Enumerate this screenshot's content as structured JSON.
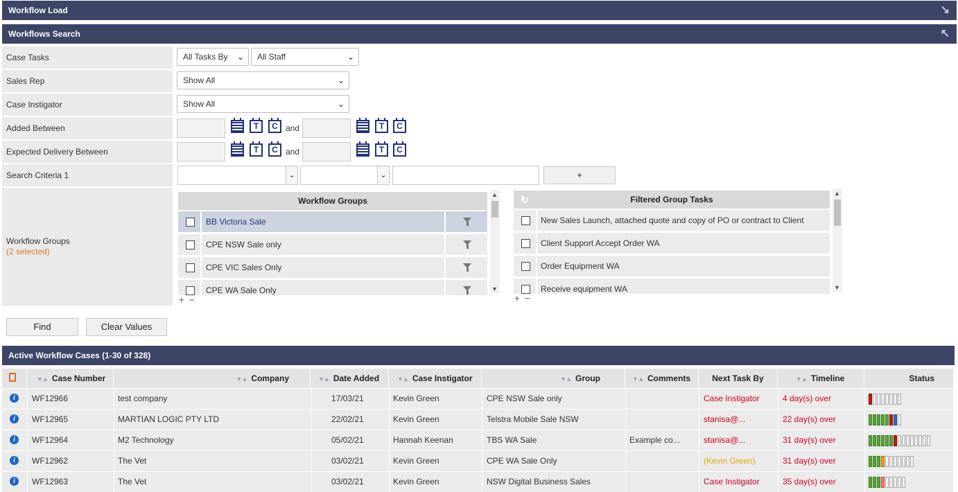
{
  "panels": {
    "workflow_load": "Workflow Load",
    "workflows_search": "Workflows Search",
    "active_cases": "Active Workflow Cases (1-30 of 328)"
  },
  "form": {
    "case_tasks_label": "Case Tasks",
    "case_tasks_by": "All Tasks By",
    "case_tasks_staff": "All Staff",
    "sales_rep_label": "Sales Rep",
    "sales_rep_value": "Show All",
    "case_instigator_label": "Case Instigator",
    "case_instigator_value": "Show All",
    "added_between_label": "Added Between",
    "expected_delivery_label": "Expected Delivery Between",
    "and_text": "and",
    "icon_t": "T",
    "icon_c": "C",
    "search_criteria_label": "Search Criteria 1",
    "add_criteria": "+",
    "workflow_groups_label": "Workflow Groups",
    "workflow_groups_selected": "(2 selected)"
  },
  "groups": {
    "header": "Workflow Groups",
    "items": [
      "BB Victoria Sale",
      "CPE NSW Sale only",
      "CPE VIC Sales Only",
      "CPE WA Sale Only"
    ]
  },
  "group_tasks": {
    "header": "Filtered Group Tasks",
    "items": [
      "New Sales Launch, attached quote and copy of PO or contract to Client",
      "Client Support Accept Order WA",
      "Order Equipment WA",
      "Receive equipment WA"
    ]
  },
  "buttons": {
    "find": "Find",
    "clear": "Clear Values"
  },
  "table": {
    "headers": {
      "case_number": "Case Number",
      "company": "Company",
      "date_added": "Date Added",
      "case_instigator": "Case Instigator",
      "group": "Group",
      "comments": "Comments",
      "next_task_by": "Next Task By",
      "timeline": "Timeline",
      "status": "Status"
    },
    "rows": [
      {
        "case": "WF12966",
        "company": "test company",
        "date": "17/03/21",
        "instigator": "Kevin Green",
        "group": "CPE NSW Sale only",
        "comments": "",
        "next": "Case Instigator",
        "next_color": "red",
        "timeline": "4 day(s) over"
      },
      {
        "case": "WF12965",
        "company": "MARTIAN LOGIC PTY LTD",
        "date": "22/02/21",
        "instigator": "Kevin Green",
        "group": "Telstra Mobile Sale NSW",
        "comments": "",
        "next": "stanisa@...",
        "next_color": "red",
        "timeline": "22 day(s) over"
      },
      {
        "case": "WF12964",
        "company": "M2 Technology",
        "date": "05/02/21",
        "instigator": "Hannah Keenan",
        "group": "TBS WA Sale",
        "comments": "Example co...",
        "next": "stanisa@...",
        "next_color": "red",
        "timeline": "31 day(s) over"
      },
      {
        "case": "WF12962",
        "company": "The Vet",
        "date": "03/02/21",
        "instigator": "Kevin Green",
        "group": "CPE WA Sale Only",
        "comments": "",
        "next": "(Kevin Green)",
        "next_color": "orange",
        "timeline": "31 day(s) over"
      },
      {
        "case": "WF12963",
        "company": "The Vet",
        "date": "03/02/21",
        "instigator": "Kevin Green",
        "group": "NSW Digital Business Sales",
        "comments": "",
        "next": "Case Instigator",
        "next_color": "red",
        "timeline": "35 day(s) over"
      }
    ],
    "status_bars": [
      "r-------",
      "gggggrb-",
      "ggggggr--------",
      "gggo-------",
      "gggp-----"
    ]
  },
  "colors": {
    "header_bar": "#3c4566",
    "overdue": "#d6001c",
    "pending": "#e8a200"
  }
}
